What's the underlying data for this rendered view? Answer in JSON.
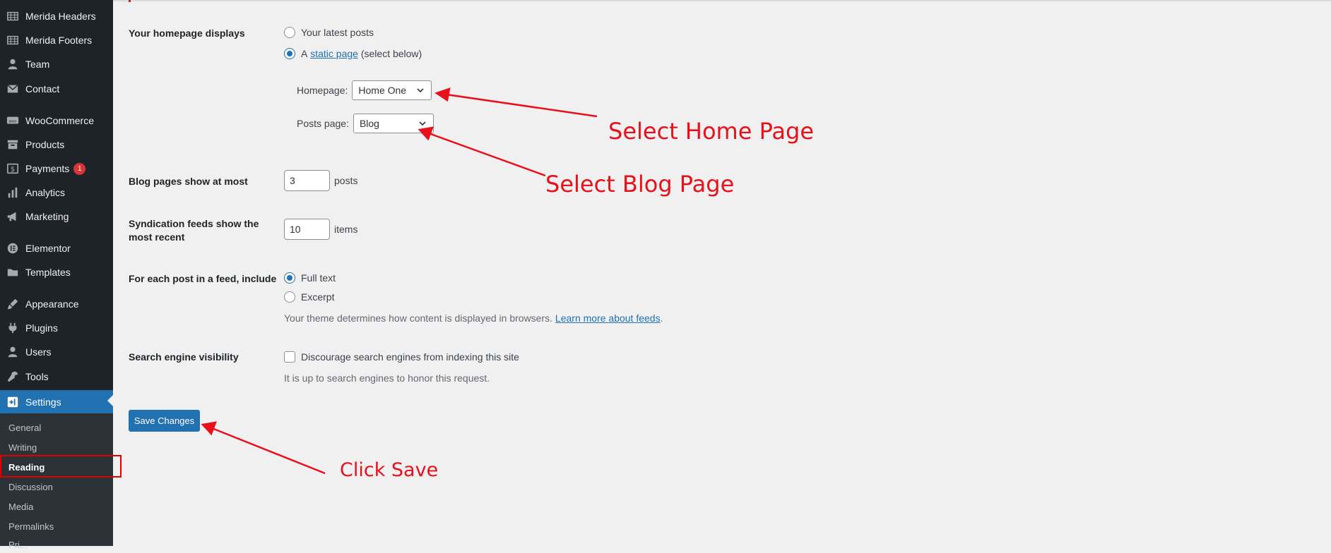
{
  "sidebar": {
    "items": [
      {
        "label": "Merida Headers",
        "icon": "grid-icon"
      },
      {
        "label": "Merida Footers",
        "icon": "grid-icon"
      },
      {
        "label": "Team",
        "icon": "person-icon"
      },
      {
        "label": "Contact",
        "icon": "envelope-icon"
      },
      {
        "label": "WooCommerce",
        "icon": "woo-icon"
      },
      {
        "label": "Products",
        "icon": "archive-icon"
      },
      {
        "label": "Payments",
        "icon": "dollar-icon",
        "badge": "1"
      },
      {
        "label": "Analytics",
        "icon": "bar-chart-icon"
      },
      {
        "label": "Marketing",
        "icon": "megaphone-icon"
      },
      {
        "label": "Elementor",
        "icon": "elementor-icon"
      },
      {
        "label": "Templates",
        "icon": "folder-icon"
      },
      {
        "label": "Appearance",
        "icon": "brush-icon"
      },
      {
        "label": "Plugins",
        "icon": "plug-icon"
      },
      {
        "label": "Users",
        "icon": "person-icon"
      },
      {
        "label": "Tools",
        "icon": "wrench-icon"
      },
      {
        "label": "Settings",
        "icon": "settings-icon",
        "active": true
      }
    ],
    "submenu": [
      "General",
      "Writing",
      "Reading",
      "Discussion",
      "Media",
      "Permalinks",
      "Pri..."
    ],
    "current_submenu": "Reading"
  },
  "form": {
    "homepage_displays": {
      "label": "Your homepage displays",
      "option_latest": "Your latest posts",
      "option_static_prefix": "A",
      "option_static_link": "static page",
      "option_static_suffix": "(select below)",
      "selected": "static"
    },
    "homepage_select": {
      "label": "Homepage:",
      "value": "Home One"
    },
    "posts_page_select": {
      "label": "Posts page:",
      "value": "Blog"
    },
    "blog_pages": {
      "label": "Blog pages show at most",
      "value": "3",
      "suffix": "posts"
    },
    "syndication": {
      "label_line1": "Syndication feeds show the",
      "label_line2": "most recent",
      "value": "10",
      "suffix": "items"
    },
    "feed_include": {
      "label": "For each post in a feed, include",
      "option_full": "Full text",
      "option_excerpt": "Excerpt",
      "selected": "full",
      "description_prefix": "Your theme determines how content is displayed in browsers.",
      "description_link": "Learn more about feeds",
      "description_suffix": "."
    },
    "search_visibility": {
      "label": "Search engine visibility",
      "checkbox_label": "Discourage search engines from indexing this site",
      "checked": false,
      "description": "It is up to search engines to honor this request."
    },
    "save_label": "Save Changes"
  },
  "annotations": {
    "select_home": "Select Home Page",
    "select_blog": "Select Blog Page",
    "click_save": "Click Save",
    "color": "#e8101a"
  },
  "colors": {
    "sidebar_bg": "#1d2327",
    "accent": "#2271b1",
    "badge": "#d63638",
    "page_bg": "#f0f0f1"
  }
}
